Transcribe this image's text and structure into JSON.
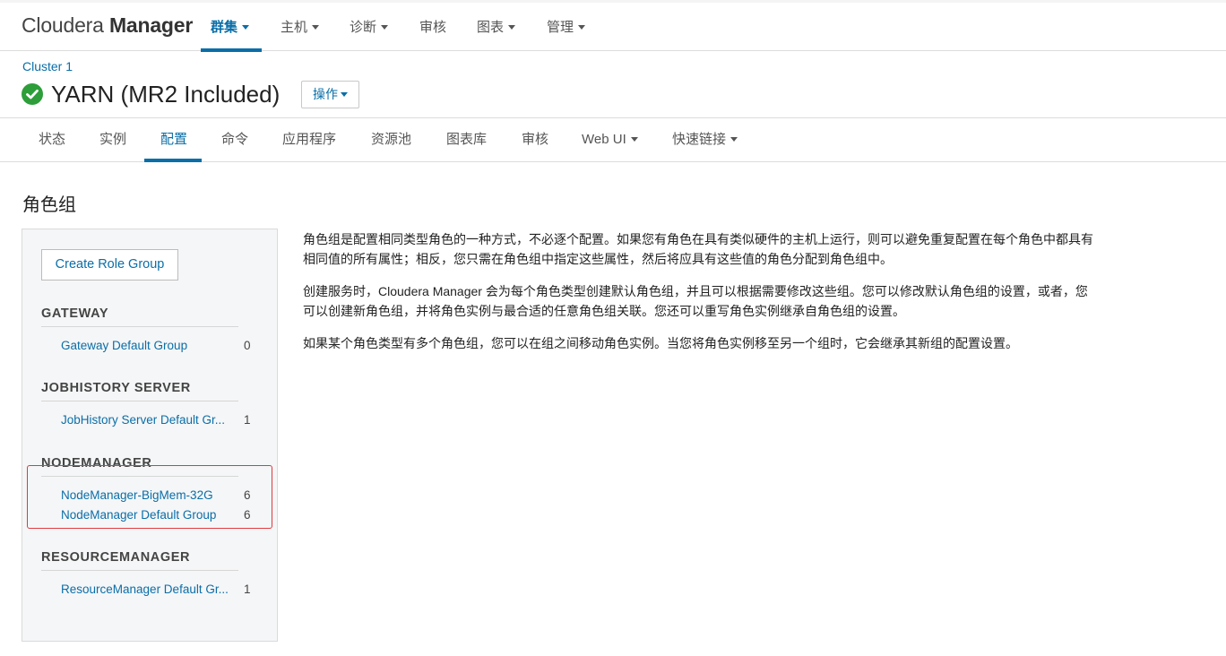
{
  "topnav": {
    "logo_light": "Cloudera ",
    "logo_bold": "Manager",
    "items": [
      {
        "label": "群集",
        "dropdown": true,
        "active": true
      },
      {
        "label": "主机",
        "dropdown": true,
        "active": false
      },
      {
        "label": "诊断",
        "dropdown": true,
        "active": false
      },
      {
        "label": "审核",
        "dropdown": false,
        "active": false
      },
      {
        "label": "图表",
        "dropdown": true,
        "active": false
      },
      {
        "label": "管理",
        "dropdown": true,
        "active": false
      }
    ]
  },
  "header": {
    "breadcrumb": "Cluster 1",
    "title": "YARN (MR2 Included)",
    "status": "good",
    "actions_label": "操作"
  },
  "subtabs": [
    {
      "label": "状态",
      "dropdown": false,
      "active": false
    },
    {
      "label": "实例",
      "dropdown": false,
      "active": false
    },
    {
      "label": "配置",
      "dropdown": false,
      "active": true
    },
    {
      "label": "命令",
      "dropdown": false,
      "active": false
    },
    {
      "label": "应用程序",
      "dropdown": false,
      "active": false
    },
    {
      "label": "资源池",
      "dropdown": false,
      "active": false
    },
    {
      "label": "图表库",
      "dropdown": false,
      "active": false
    },
    {
      "label": "审核",
      "dropdown": false,
      "active": false
    },
    {
      "label": "Web UI",
      "dropdown": true,
      "active": false
    },
    {
      "label": "快速链接",
      "dropdown": true,
      "active": false
    }
  ],
  "section": {
    "title": "角色组",
    "create_button": "Create Role Group"
  },
  "groups": [
    {
      "header": "GATEWAY",
      "items": [
        {
          "name": "Gateway Default Group",
          "count": "0"
        }
      ]
    },
    {
      "header": "JOBHISTORY SERVER",
      "items": [
        {
          "name": "JobHistory Server Default Gr...",
          "count": "1"
        }
      ]
    },
    {
      "header": "NODEMANAGER",
      "items": [
        {
          "name": "NodeManager-BigMem-32G",
          "count": "6"
        },
        {
          "name": "NodeManager Default Group",
          "count": "6"
        }
      ]
    },
    {
      "header": "RESOURCEMANAGER",
      "items": [
        {
          "name": "ResourceManager Default Gr...",
          "count": "1"
        }
      ]
    }
  ],
  "description": [
    "角色组是配置相同类型角色的一种方式，不必逐个配置。如果您有角色在具有类似硬件的主机上运行，则可以避免重复配置在每个角色中都具有相同值的所有属性；相反，您只需在角色组中指定这些属性，然后将应具有这些值的角色分配到角色组中。",
    "创建服务时，Cloudera Manager 会为每个角色类型创建默认角色组，并且可以根据需要修改这些组。您可以修改默认角色组的设置，或者，您可以创建新角色组，并将角色实例与最合适的任意角色组关联。您还可以重写角色实例继承自角色组的设置。",
    "如果某个角色类型有多个角色组，您可以在组之间移动角色实例。当您将角色实例移至另一个组时，它会继承其新组的配置设置。"
  ],
  "colors": {
    "accent": "#0a6ea8",
    "status_good": "#2d9e3a",
    "highlight": "#e0393e"
  }
}
